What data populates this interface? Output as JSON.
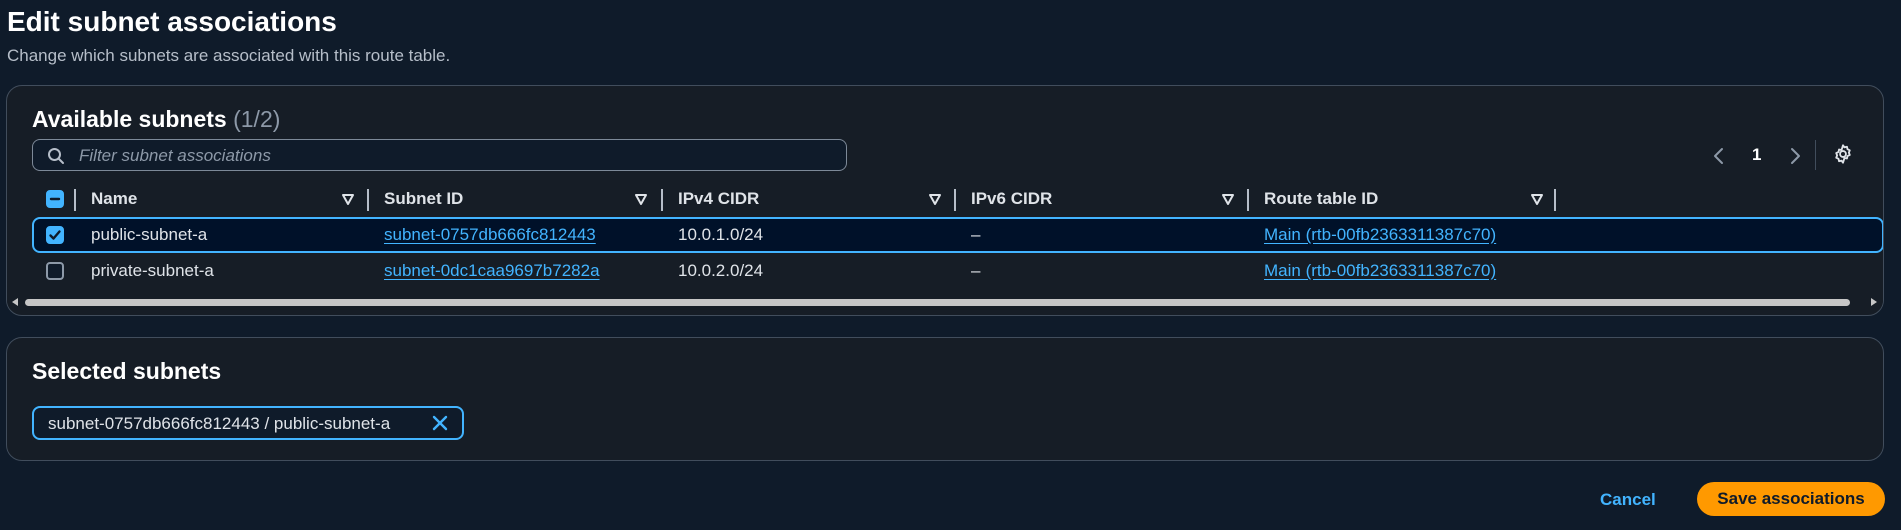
{
  "page": {
    "title": "Edit subnet associations",
    "subtitle": "Change which subnets are associated with this route table."
  },
  "available": {
    "heading": "Available subnets",
    "count": "(1/2)",
    "search_placeholder": "Filter subnet associations",
    "pagination": {
      "current_page": "1"
    },
    "columns": [
      "Name",
      "Subnet ID",
      "IPv4 CIDR",
      "IPv6 CIDR",
      "Route table ID"
    ],
    "rows": [
      {
        "checked": true,
        "name": "public-subnet-a",
        "subnet_id": "subnet-0757db666fc812443",
        "ipv4": "10.0.1.0/24",
        "ipv6": "–",
        "route_table": "Main (rtb-00fb2363311387c70)"
      },
      {
        "checked": false,
        "name": "private-subnet-a",
        "subnet_id": "subnet-0dc1caa9697b7282a",
        "ipv4": "10.0.2.0/24",
        "ipv6": "–",
        "route_table": "Main (rtb-00fb2363311387c70)"
      }
    ]
  },
  "selected": {
    "heading": "Selected subnets",
    "tokens": [
      {
        "label": "subnet-0757db666fc812443 / public-subnet-a"
      }
    ]
  },
  "footer": {
    "cancel_label": "Cancel",
    "save_label": "Save associations"
  },
  "colors": {
    "background": "#0f1b2a",
    "panel": "#161d26",
    "accent": "#42b4ff",
    "primary_button": "#ff9900"
  }
}
